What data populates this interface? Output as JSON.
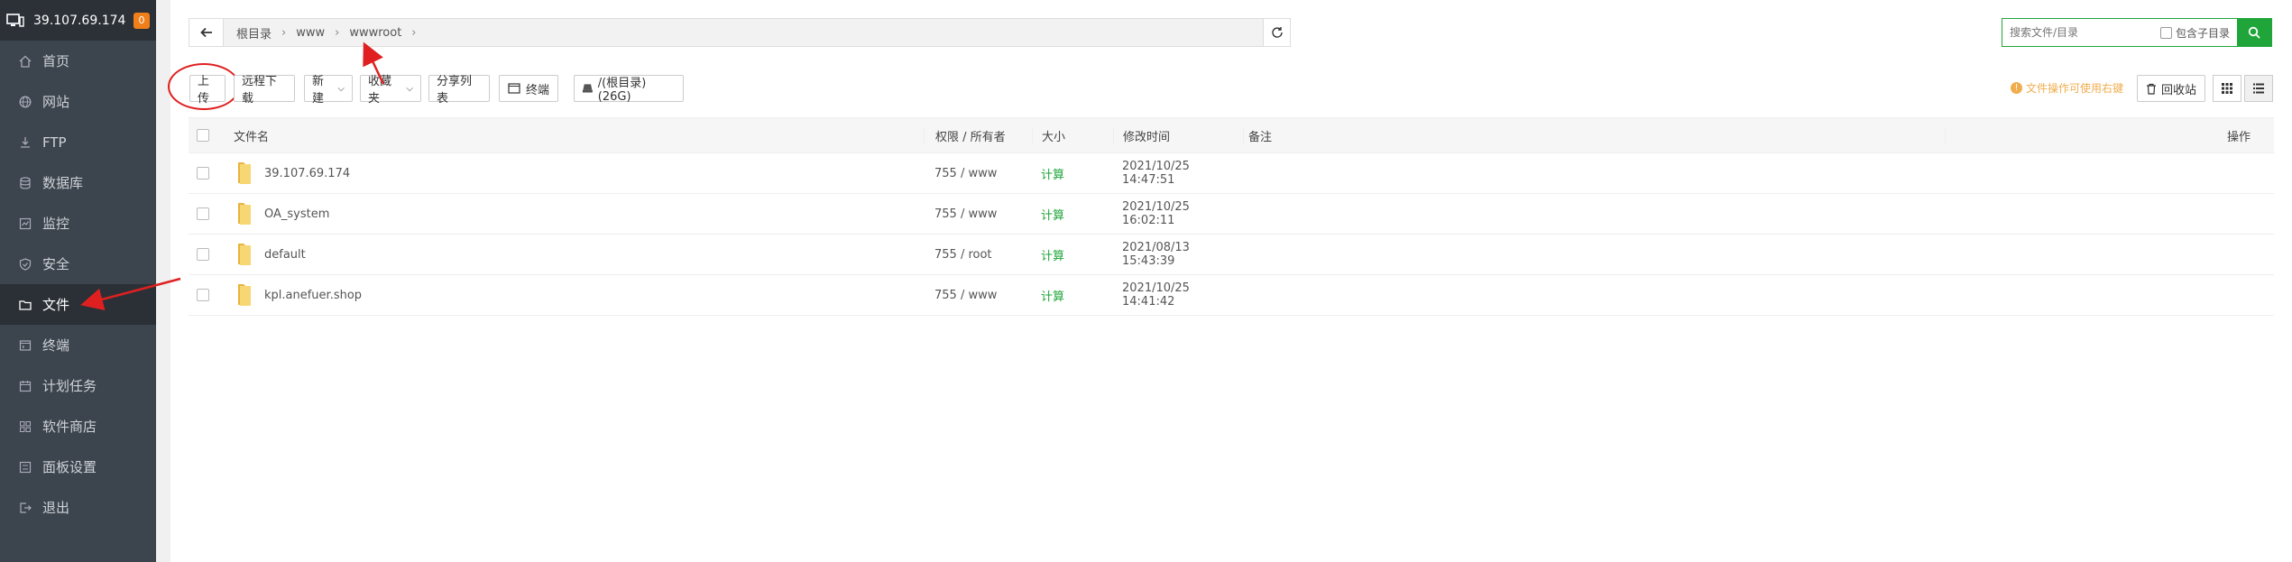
{
  "server": {
    "ip": "39.107.69.174",
    "badge": "0"
  },
  "sidebar": {
    "items": [
      {
        "label": "首页",
        "icon": "home-icon"
      },
      {
        "label": "网站",
        "icon": "globe-icon"
      },
      {
        "label": "FTP",
        "icon": "ftp-icon"
      },
      {
        "label": "数据库",
        "icon": "database-icon"
      },
      {
        "label": "监控",
        "icon": "monitor-icon"
      },
      {
        "label": "安全",
        "icon": "shield-icon"
      },
      {
        "label": "文件",
        "icon": "folder-icon",
        "active": true
      },
      {
        "label": "终端",
        "icon": "terminal-icon"
      },
      {
        "label": "计划任务",
        "icon": "calendar-icon"
      },
      {
        "label": "软件商店",
        "icon": "apps-icon"
      },
      {
        "label": "面板设置",
        "icon": "settings-icon"
      },
      {
        "label": "退出",
        "icon": "logout-icon"
      }
    ]
  },
  "path": {
    "crumbs": [
      "根目录",
      "www",
      "wwwroot"
    ]
  },
  "search": {
    "placeholder": "搜索文件/目录",
    "sub_label": "包含子目录"
  },
  "toolbar": {
    "upload": "上传",
    "remote_download": "远程下载",
    "new": "新建",
    "favorites": "收藏夹",
    "share_list": "分享列表",
    "terminal": "终端",
    "disk": "/(根目录) (26G)",
    "tip": "文件操作可使用右键",
    "recycle": "回收站"
  },
  "table": {
    "headers": {
      "name": "文件名",
      "perm": "权限 / 所有者",
      "size": "大小",
      "time": "修改时间",
      "note": "备注",
      "op": "操作"
    },
    "rows": [
      {
        "name": "39.107.69.174",
        "perm": "755 / www",
        "size": "计算",
        "time": "2021/10/25 14:47:51"
      },
      {
        "name": "OA_system",
        "perm": "755 / www",
        "size": "计算",
        "time": "2021/10/25 16:02:11"
      },
      {
        "name": "default",
        "perm": "755 / root",
        "size": "计算",
        "time": "2021/08/13 15:43:39"
      },
      {
        "name": "kpl.anefuer.shop",
        "perm": "755 / www",
        "size": "计算",
        "time": "2021/10/25 14:41:42"
      }
    ]
  },
  "colors": {
    "accent": "#20a53a",
    "sidebar": "#3c444d",
    "annotation": "#e02020"
  }
}
